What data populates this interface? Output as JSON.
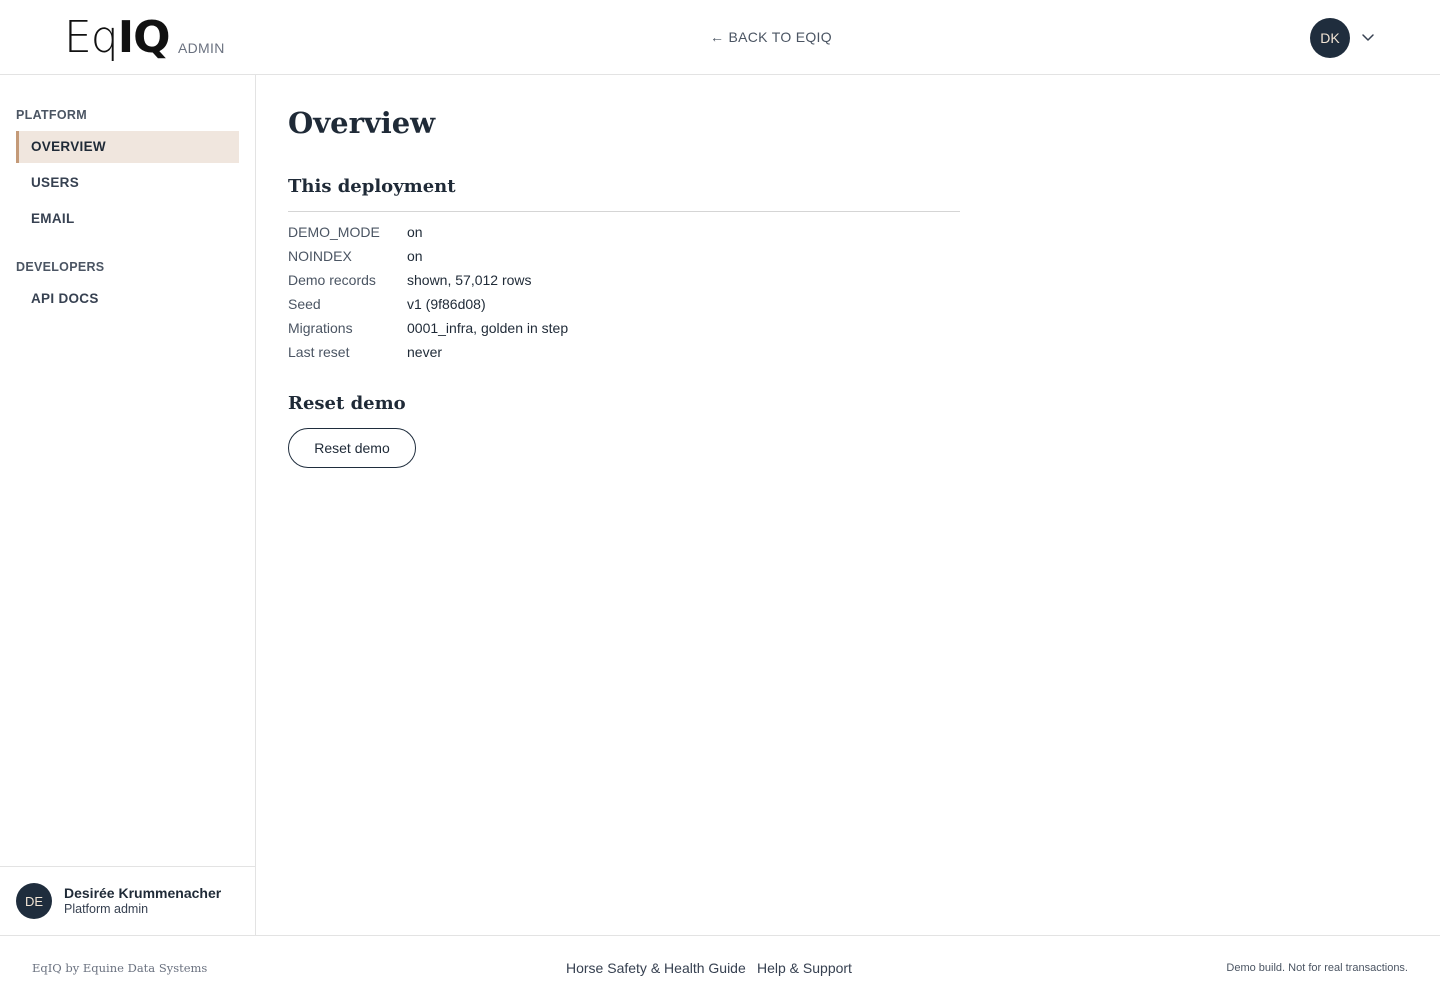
{
  "header": {
    "logo_light": "Eq",
    "logo_bold": "IQ",
    "admin_tag": "ADMIN",
    "back_link": "← BACK TO EQIQ",
    "avatar_initials": "DK"
  },
  "sidebar": {
    "sections": [
      {
        "label": "PLATFORM",
        "items": [
          "OVERVIEW",
          "USERS",
          "EMAIL"
        ]
      },
      {
        "label": "DEVELOPERS",
        "items": [
          "API DOCS"
        ]
      }
    ],
    "active_item": "OVERVIEW",
    "user": {
      "initials": "DE",
      "name": "Desirée Krummenacher",
      "role": "Platform admin"
    }
  },
  "main": {
    "title": "Overview",
    "deployment": {
      "heading": "This deployment",
      "rows": [
        {
          "key": "DEMO_MODE",
          "value": "on"
        },
        {
          "key": "NOINDEX",
          "value": "on"
        },
        {
          "key": "Demo records",
          "value": "shown, 57,012 rows"
        },
        {
          "key": "Seed",
          "value": "v1 (9f86d08)"
        },
        {
          "key": "Migrations",
          "value": "0001_infra, golden in step"
        },
        {
          "key": "Last reset",
          "value": "never"
        }
      ]
    },
    "reset": {
      "heading": "Reset demo",
      "button_label": "Reset demo"
    }
  },
  "footer": {
    "brand": "EqIQ by Equine Data Systems",
    "links": [
      "Horse Safety & Health Guide",
      "Help & Support"
    ],
    "note": "Demo build. Not for real transactions."
  },
  "colors": {
    "navy": "#1f2d3d",
    "active_bg": "#f0e6de",
    "active_accent": "#c49a78"
  }
}
